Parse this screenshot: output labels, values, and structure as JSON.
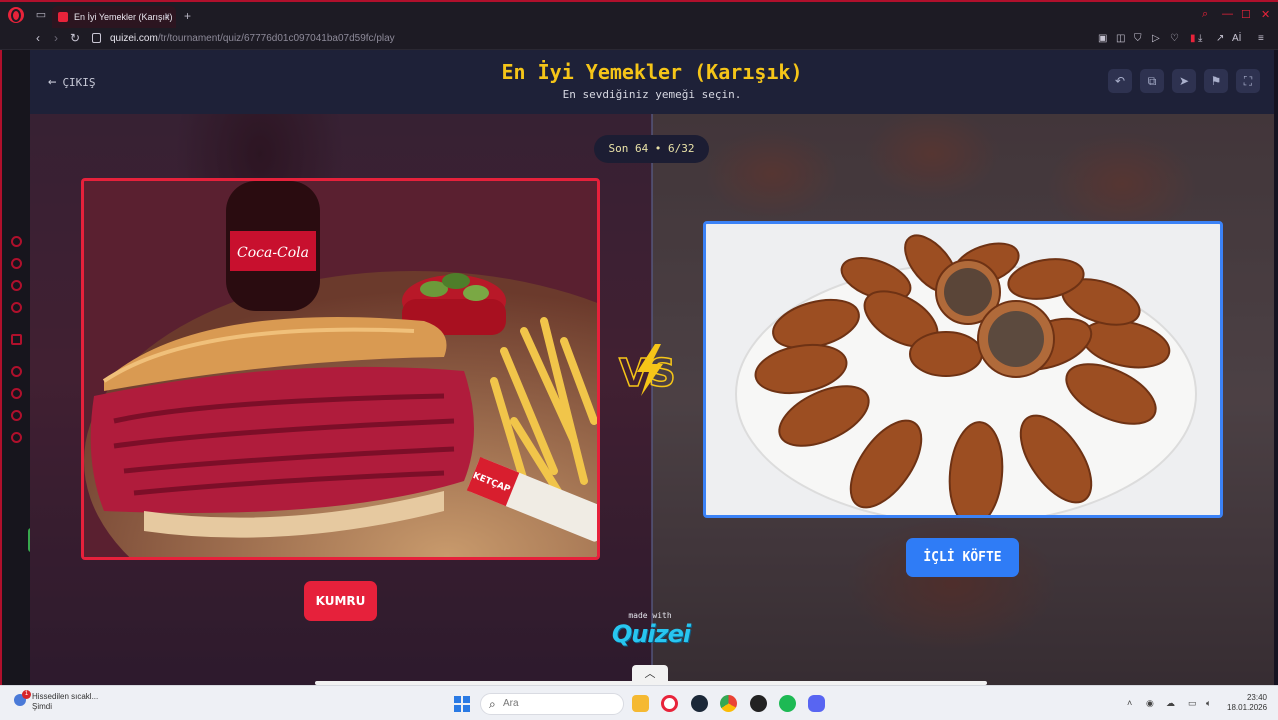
{
  "browser": {
    "tab_title": "En İyi Yemekler (Karışık)",
    "tab_close": "×",
    "new_tab": "+",
    "url_host": "quizei.com",
    "url_path": "/tr/tournament/quiz/67776d01c097041ba07d59fc/play",
    "ai_label": "Aİ"
  },
  "quiz": {
    "exit_label": "ÇIKIŞ",
    "title": "En İyi Yemekler (Karışık)",
    "subtitle": "En sevdiğiniz yemeği seçin.",
    "round_label": "Son 64 • 6/32",
    "made_with": "made with",
    "brand": "Quizei",
    "left_option": "KUMRU",
    "right_option": "İÇLİ KÖFTE",
    "left_bottle_text": "Coca-Cola",
    "left_packet_text": "KETÇAP"
  },
  "taskbar": {
    "weather_text_1": "Hissedilen sıcakl...",
    "weather_text_2": "Şimdi",
    "weather_badge": "1",
    "search_placeholder": "Ara",
    "time": "23:40",
    "date": "18.01.2026"
  },
  "colors": {
    "accent_left": "#e6213b",
    "accent_right": "#2f7cf6",
    "title_yellow": "#f5c518",
    "brand_cyan": "#28c6f0"
  }
}
